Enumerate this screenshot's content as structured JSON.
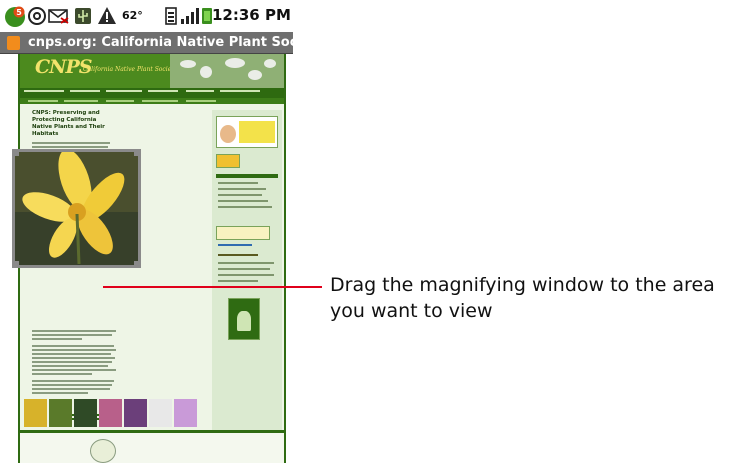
{
  "status_bar": {
    "time": "12:36 PM",
    "temperature": "62°",
    "icons": [
      "notification-badge-icon",
      "email-icon",
      "missed-mail-icon",
      "usb-icon",
      "warning-icon",
      "sim-icon",
      "signal-icon",
      "battery-icon"
    ],
    "badge_count": "5"
  },
  "browser": {
    "tab_title": "cnps.org: California Native Plant Soci..."
  },
  "webpage": {
    "logo": "CNPS",
    "tagline": "California Native Plant Society",
    "main_heading": "CNPS: Preserving and Protecting California Native Plants and Their Habitats"
  },
  "callout": {
    "line1": "Drag the magnifying window to the area",
    "line2": "you want to view"
  },
  "colors": {
    "accent": "#e0001b",
    "page_green": "#2f6b12",
    "title_bar": "#6f6f6f"
  }
}
